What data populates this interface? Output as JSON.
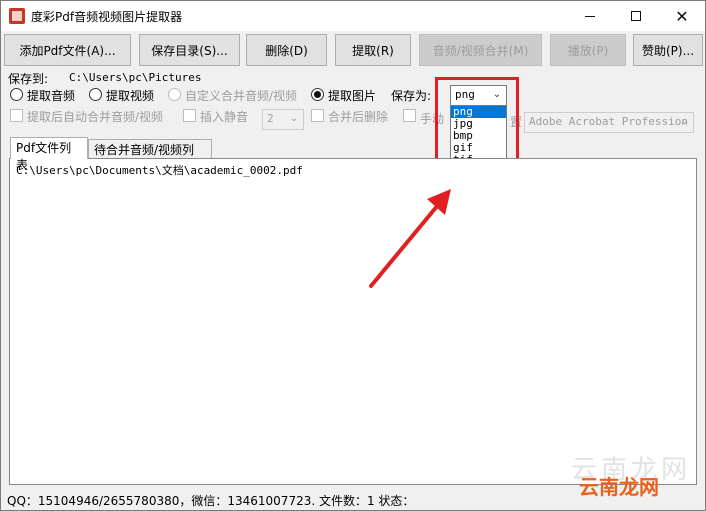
{
  "window": {
    "title": "度彩Pdf音频视频图片提取器",
    "min_label": "",
    "max_label": "",
    "close_label": "✕"
  },
  "toolbar": {
    "add_pdf": "添加Pdf文件(A)...",
    "save_dir": "保存目录(S)...",
    "delete": "删除(D)",
    "extract": "提取(R)",
    "merge_av": "音频/视频合并(M)",
    "play": "播放(P)",
    "donate": "赞助(P)..."
  },
  "save_to": {
    "label": "保存到:",
    "path": "C:\\Users\\pc\\Pictures"
  },
  "options": {
    "extract_audio": "提取音频",
    "extract_video": "提取视频",
    "custom_merge": "自定义合并音频/视频",
    "extract_image": "提取图片",
    "save_as_label": "保存为:",
    "save_as_value": "png",
    "auto_merge": "提取后自动合并音频/视频",
    "insert_silence": "插入静音",
    "silence_value": "2",
    "delete_after_merge": "合并后删除",
    "manual": "手动",
    "manual_suffix": "置",
    "printer_value": "Adobe Acrobat Profession"
  },
  "format_options": [
    "png",
    "jpg",
    "bmp",
    "gif",
    "tif"
  ],
  "tabs": {
    "pdf_list": "Pdf文件列表",
    "merge_list": "待合并音频/视频列表"
  },
  "files": [
    "C:\\Users\\pc\\Documents\\文档\\academic_0002.pdf"
  ],
  "status": "QQ：15104946/2655780380，微信：13461007723. 文件数：1  状态：",
  "watermark": {
    "faint": "云南龙网",
    "brand": "云南龙网"
  },
  "colors": {
    "highlight": "#e02020",
    "selection": "#0078d7",
    "watermark": "#e8621f"
  }
}
